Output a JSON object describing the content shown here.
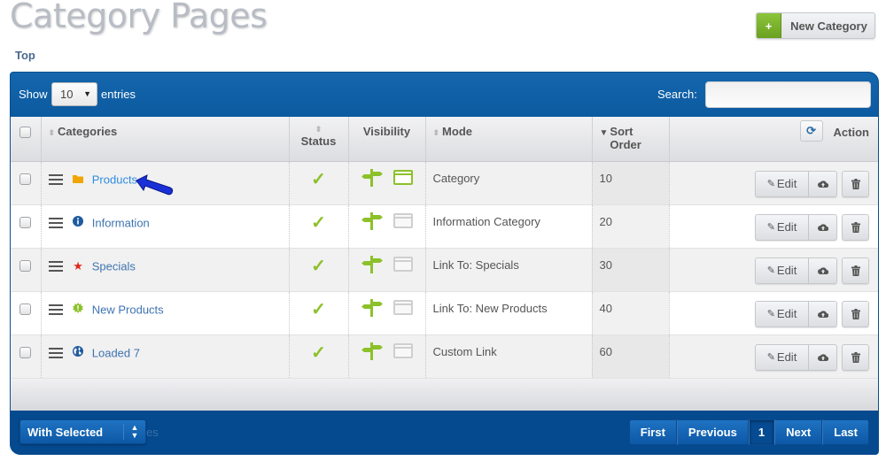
{
  "page": {
    "title": "Category Pages",
    "breadcrumb": "Top",
    "new_button": {
      "icon": "+",
      "label": "New Category"
    }
  },
  "toolbar": {
    "show_label": "Show",
    "length_value": "10",
    "entries_label": "entries",
    "search_label": "Search:",
    "search_value": "",
    "search_placeholder": ""
  },
  "table": {
    "columns": [
      {
        "key": "select",
        "label": ""
      },
      {
        "key": "categories",
        "label": "Categories",
        "sortable": true
      },
      {
        "key": "status",
        "label": "Status",
        "sortable": true
      },
      {
        "key": "visibility",
        "label": "Visibility",
        "sortable": false
      },
      {
        "key": "mode",
        "label": "Mode",
        "sortable": true
      },
      {
        "key": "sort_order",
        "label": "Sort Order",
        "sort_direction": "descending-indicator"
      },
      {
        "key": "action",
        "label": "Action"
      }
    ],
    "rows": [
      {
        "name": "Products",
        "icon": "folder-icon",
        "icon_color": "#f0a500",
        "status": "active",
        "nav_visible": true,
        "page_visible": true,
        "mode": "Category",
        "sort_order": "10",
        "highlighted": true
      },
      {
        "name": "Information",
        "icon": "info-icon",
        "icon_color": "#1f5b9e",
        "status": "active",
        "nav_visible": true,
        "page_visible": false,
        "mode": "Information Category",
        "sort_order": "20"
      },
      {
        "name": "Specials",
        "icon": "star-icon",
        "icon_color": "#e0291b",
        "status": "active",
        "nav_visible": true,
        "page_visible": false,
        "mode": "Link To: Specials",
        "sort_order": "30"
      },
      {
        "name": "New Products",
        "icon": "new-badge-icon",
        "icon_color": "#8cc12a",
        "status": "active",
        "nav_visible": true,
        "page_visible": false,
        "mode": "Link To: New Products",
        "sort_order": "40"
      },
      {
        "name": "Loaded 7",
        "icon": "globe-icon",
        "icon_color": "#1f5b9e",
        "status": "active",
        "nav_visible": true,
        "page_visible": false,
        "mode": "Custom Link",
        "sort_order": "60"
      }
    ],
    "row_actions": {
      "edit_label": "Edit"
    }
  },
  "footer": {
    "with_selected_label": "With Selected",
    "ghost_text": "es",
    "pagination": [
      "First",
      "Previous",
      "1",
      "Next",
      "Last"
    ],
    "current_page": "1"
  },
  "colors": {
    "panel_blue": "#0a5aa0",
    "status_green": "#8cc12a",
    "link_blue": "#3f74b0"
  }
}
